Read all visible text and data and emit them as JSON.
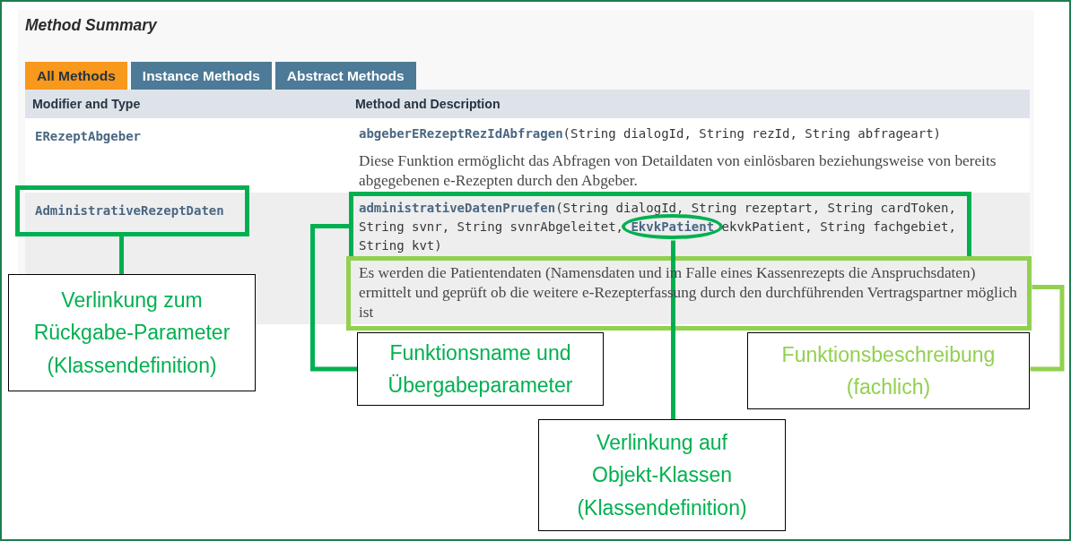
{
  "summary": {
    "title": "Method Summary",
    "tabs": [
      {
        "label": "All Methods",
        "selected": true
      },
      {
        "label": "Instance Methods",
        "selected": false
      },
      {
        "label": "Abstract Methods",
        "selected": false
      }
    ],
    "columns": [
      "Modifier and Type",
      "Method and Description"
    ],
    "rows": [
      {
        "type": "ERezeptAbgeber",
        "framed": false,
        "signature": [
          {
            "kind": "method",
            "text": "abgeberERezeptRezIdAbfragen",
            "circled": false
          },
          {
            "kind": "code",
            "text": "(String dialogId, String rezId, String abfrageart)"
          }
        ],
        "description": "Diese Funktion ermöglicht das Abfragen von Detaildaten von einlösbaren beziehungsweise von bereits abgegebenen e-Rezepten durch den Abgeber."
      },
      {
        "type": "AdministrativeRezeptDaten",
        "framed": true,
        "signature": [
          {
            "kind": "method",
            "text": "administrativeDatenPruefen",
            "circled": false
          },
          {
            "kind": "code",
            "text": "(String dialogId, String rezeptart, String cardToken, String svnr, String svnrAbgeleitet, "
          },
          {
            "kind": "type_link",
            "text": "EkvkPatient",
            "circled": true
          },
          {
            "kind": "code",
            "text": " ekvkPatient, String fachgebiet, String kvt)"
          }
        ],
        "description": "Es werden die Patientendaten (Namensdaten und im Falle eines Kassenrezepts die Anspruchsdaten) ermittelt und geprüft ob die weitere e-Rezepterfassung durch den durchführenden Vertragspartner möglich ist"
      }
    ]
  },
  "annotations": [
    {
      "color": "#00b050",
      "lines": [
        "Verlinkung zum",
        "Rückgabe-Parameter",
        "(Klassendefinition)"
      ]
    },
    {
      "color": "#00b050",
      "lines": [
        "Funktionsname und",
        "Übergabeparameter"
      ]
    },
    {
      "color": "#00b050",
      "lines": [
        "Verlinkung auf",
        "Objekt-Klassen",
        "(Klassendefinition)"
      ]
    },
    {
      "color": "#92d050",
      "lines": [
        "Funktionsbeschreibung",
        "(fachlich)"
      ]
    }
  ]
}
